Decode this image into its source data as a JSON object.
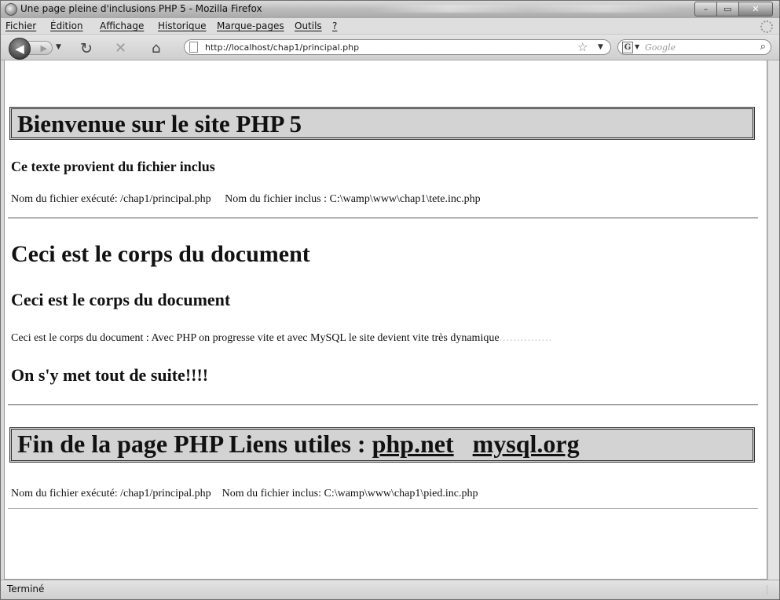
{
  "window": {
    "title": "Une page pleine d'inclusions PHP 5 - Mozilla Firefox",
    "controls": {
      "minimize": "–",
      "maximize": "▭",
      "close": "✕"
    }
  },
  "menu": {
    "items": [
      "Fichier",
      "Édition",
      "Affichage",
      "Historique",
      "Marque-pages",
      "Outils",
      "?"
    ]
  },
  "nav": {
    "url": "http://localhost/chap1/principal.php",
    "search_placeholder": "Google",
    "search_engine_icon": "G",
    "icons": {
      "back": "back-arrow-icon",
      "forward": "forward-arrow-icon",
      "reload": "reload-icon",
      "stop": "stop-icon",
      "home": "home-icon",
      "bookmark": "star-icon",
      "search": "magnifier-icon"
    }
  },
  "page": {
    "header_title": "Bienvenue sur le site PHP 5",
    "include_heading": "Ce texte provient du fichier inclus",
    "include_info": "Nom du fichier exécuté: /chap1/principal.php     Nom du fichier inclus : C:\\wamp\\www\\chap1\\tete.inc.php",
    "body_h1": "Ceci est le corps du document",
    "body_h2": "Ceci est le corps du document",
    "body_paragraph": "Ceci est le corps du document : Avec PHP on progresse vite et avec MySQL le site devient vite très dynamique",
    "body_paragraph_dots": "...............",
    "body_h3": "On s'y met tout de suite!!!!",
    "footer_title": "Fin de la page PHP Liens utiles :",
    "footer_link_php": "php.net",
    "footer_link_mysql": "mysql.org",
    "footer_info": "Nom du fichier exécuté: /chap1/principal.php    Nom du fichier inclus: C:\\wamp\\www\\chap1\\pied.inc.php"
  },
  "status": {
    "text": "Terminé"
  }
}
